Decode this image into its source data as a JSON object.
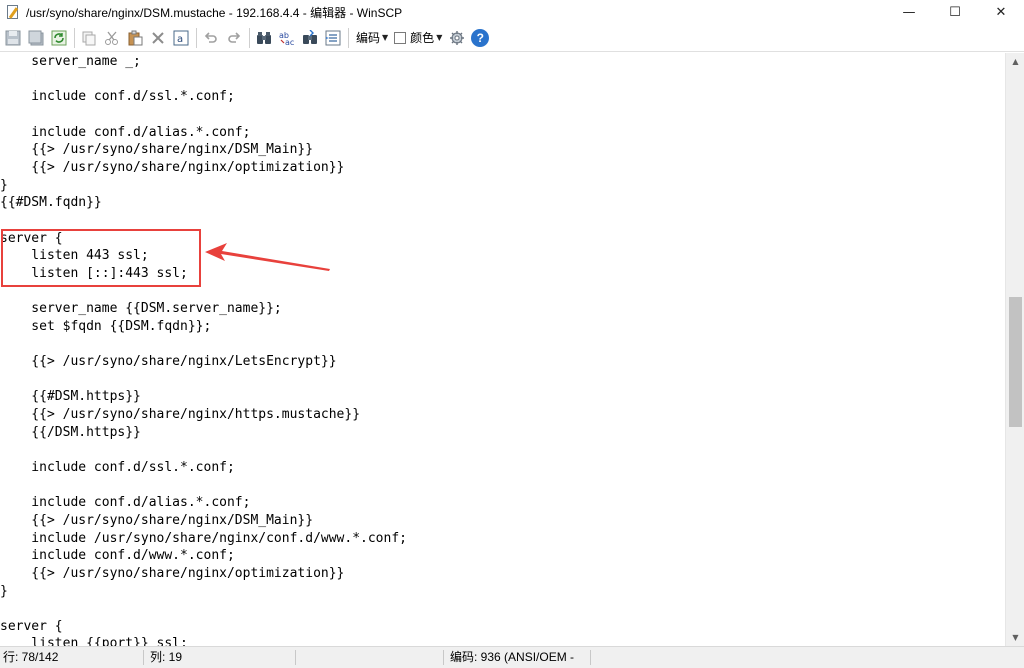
{
  "window": {
    "title": "/usr/syno/share/nginx/DSM.mustache - 192.168.4.4 - 编辑器 - WinSCP",
    "controls": {
      "minimize": "—",
      "maximize": "☐",
      "close": "✕"
    }
  },
  "toolbar": {
    "encoding_label": "编码",
    "color_label": "颜色",
    "help_label": "?"
  },
  "editor": {
    "lines": [
      "    server_name _;",
      "",
      "    include conf.d/ssl.*.conf;",
      "",
      "    include conf.d/alias.*.conf;",
      "    {{> /usr/syno/share/nginx/DSM_Main}}",
      "    {{> /usr/syno/share/nginx/optimization}}",
      "}",
      "{{#DSM.fqdn}}",
      "",
      "server {",
      "    listen 443 ssl;",
      "    listen [::]:443 ssl;",
      "",
      "    server_name {{DSM.server_name}};",
      "    set $fqdn {{DSM.fqdn}};",
      "",
      "    {{> /usr/syno/share/nginx/LetsEncrypt}}",
      "",
      "    {{#DSM.https}}",
      "    {{> /usr/syno/share/nginx/https.mustache}}",
      "    {{/DSM.https}}",
      "",
      "    include conf.d/ssl.*.conf;",
      "",
      "    include conf.d/alias.*.conf;",
      "    {{> /usr/syno/share/nginx/DSM_Main}}",
      "    include /usr/syno/share/nginx/conf.d/www.*.conf;",
      "    include conf.d/www.*.conf;",
      "    {{> /usr/syno/share/nginx/optimization}}",
      "}",
      "",
      "server {",
      "    listen {{port}} ssl;"
    ]
  },
  "status": {
    "line": "行: 78/142",
    "column": "列: 19",
    "encoding": "编码:  936   (ANSI/OEM -"
  },
  "colors": {
    "annotation": "#e8413c",
    "help": "#2a73cc"
  }
}
